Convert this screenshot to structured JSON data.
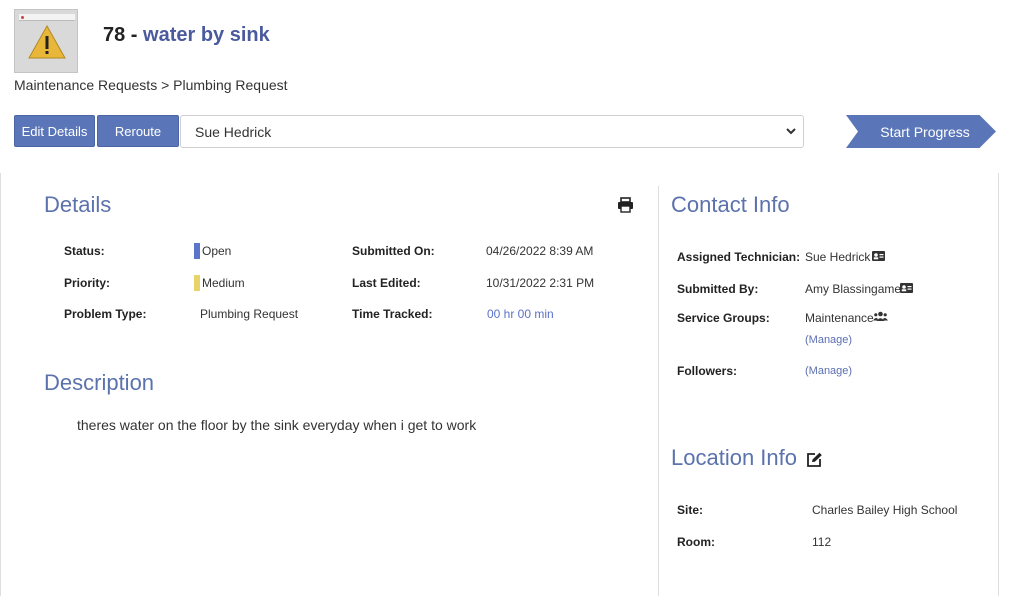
{
  "header": {
    "request_number": "78 - ",
    "request_title": "water by sink",
    "breadcrumb": "Maintenance Requests > Plumbing Request"
  },
  "toolbar": {
    "edit_label": "Edit Details",
    "reroute_label": "Reroute",
    "assignee_selected": "Sue Hedrick",
    "start_progress_label": "Start Progress"
  },
  "details": {
    "heading": "Details",
    "status_label": "Status:",
    "status_value": "Open",
    "status_color": "#5b76c8",
    "priority_label": "Priority:",
    "priority_value": "Medium",
    "priority_color": "#e8d36a",
    "problem_type_label": "Problem Type:",
    "problem_type_value": "Plumbing Request",
    "submitted_on_label": "Submitted On:",
    "submitted_on_value": "04/26/2022 8:39 AM",
    "last_edited_label": "Last Edited:",
    "last_edited_value": "10/31/2022 2:31 PM",
    "time_tracked_label": "Time Tracked:",
    "time_tracked_value": "00 hr 00 min"
  },
  "description": {
    "heading": "Description",
    "text": "theres water on the floor by the sink everyday when i get to work"
  },
  "contact": {
    "heading": "Contact Info",
    "assigned_label": "Assigned Technician:",
    "assigned_value": "Sue Hedrick",
    "submitted_by_label": "Submitted By:",
    "submitted_by_value": "Amy Blassingame",
    "service_groups_label": "Service Groups:",
    "service_groups_value": "Maintenance",
    "manage_label": "(Manage)",
    "followers_label": "Followers:",
    "followers_manage": "(Manage)"
  },
  "location": {
    "heading": "Location Info",
    "site_label": "Site:",
    "site_value": "Charles Bailey High School",
    "room_label": "Room:",
    "room_value": "112"
  },
  "icons": {
    "warning": "warning-icon",
    "print": "printer-icon",
    "contact_card": "contact-card-icon",
    "group": "users-group-icon",
    "edit": "edit-icon",
    "chevron": "chevron-down-icon"
  }
}
